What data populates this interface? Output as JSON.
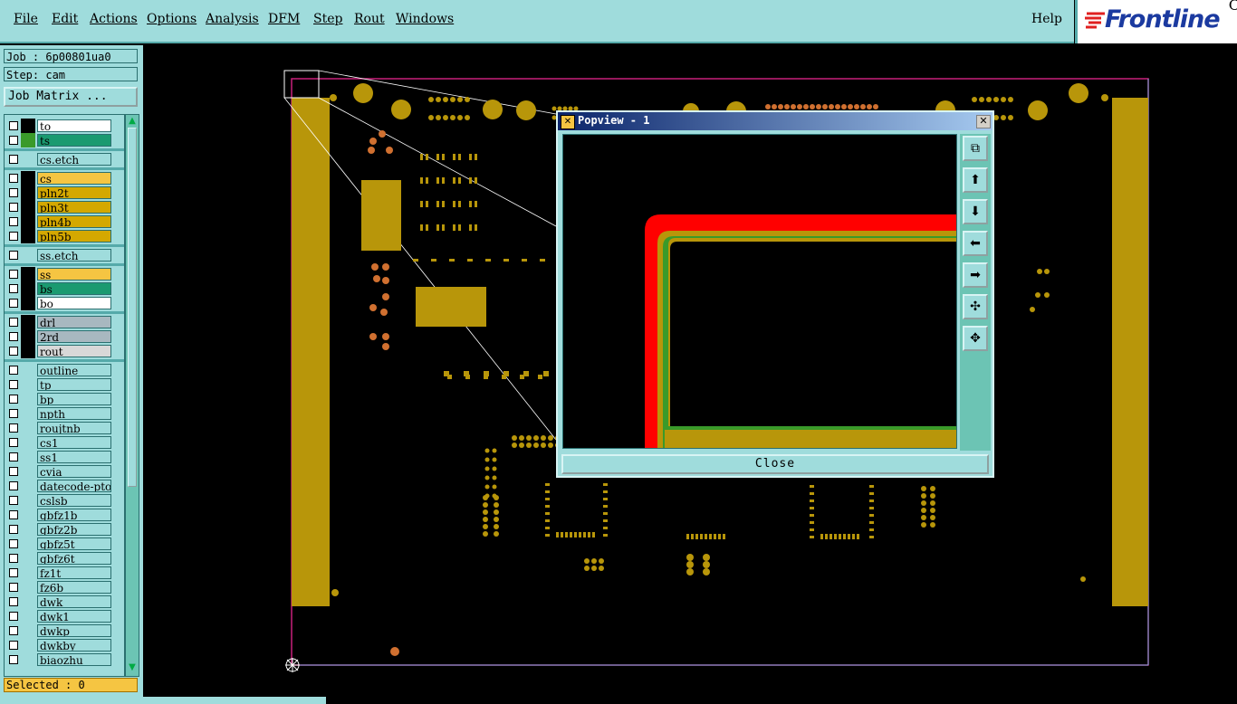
{
  "menubar": {
    "items": [
      "File",
      "Edit",
      "Actions",
      "Options",
      "Analysis",
      "DFM",
      "Step",
      "Rout",
      "Windows"
    ],
    "help": "Help"
  },
  "logo": {
    "text": "Frontline",
    "corner": "C"
  },
  "job": {
    "label": "Job : 6p00801ua0",
    "step": "Step: cam",
    "matrix_button": "Job Matrix ..."
  },
  "layers": [
    {
      "name": "to",
      "color": "#000000",
      "bg": "#ffffff",
      "group": 1
    },
    {
      "name": "ts",
      "color": "#3a9a2a",
      "bg": "#1a9a70",
      "group": 1
    },
    {
      "name": "cs.etch",
      "color": "#9fdcdc",
      "bg": "#9fdcdc",
      "group": 2
    },
    {
      "name": "cs",
      "color": "#000000",
      "bg": "#f5c542",
      "group": 3
    },
    {
      "name": "pln2t",
      "color": "#000000",
      "bg": "#d4a800",
      "group": 3
    },
    {
      "name": "pln3t",
      "color": "#000000",
      "bg": "#d4a800",
      "group": 3
    },
    {
      "name": "pln4b",
      "color": "#000000",
      "bg": "#d4a800",
      "group": 3
    },
    {
      "name": "pln5b",
      "color": "#000000",
      "bg": "#d4a800",
      "group": 3
    },
    {
      "name": "ss.etch",
      "color": "#9fdcdc",
      "bg": "#9fdcdc",
      "group": 4
    },
    {
      "name": "ss",
      "color": "#000000",
      "bg": "#f5c542",
      "group": 5
    },
    {
      "name": "bs",
      "color": "#000000",
      "bg": "#1a9a70",
      "group": 5
    },
    {
      "name": "bo",
      "color": "#000000",
      "bg": "#ffffff",
      "group": 5
    },
    {
      "name": "drl",
      "color": "#000000",
      "bg": "#a8b8c0",
      "group": 6
    },
    {
      "name": "2rd",
      "color": "#000000",
      "bg": "#a8b8c0",
      "group": 6
    },
    {
      "name": "rout",
      "color": "#000000",
      "bg": "#d8d8d8",
      "group": 6
    },
    {
      "name": "outline",
      "color": "#9fdcdc",
      "bg": "#9fdcdc",
      "group": 7
    },
    {
      "name": "tp",
      "color": "#9fdcdc",
      "bg": "#9fdcdc",
      "group": 7
    },
    {
      "name": "bp",
      "color": "#9fdcdc",
      "bg": "#9fdcdc",
      "group": 7
    },
    {
      "name": "npth",
      "color": "#9fdcdc",
      "bg": "#9fdcdc",
      "group": 7
    },
    {
      "name": "roujtnb",
      "color": "#9fdcdc",
      "bg": "#9fdcdc",
      "group": 7
    },
    {
      "name": "cs1",
      "color": "#9fdcdc",
      "bg": "#9fdcdc",
      "group": 7
    },
    {
      "name": "ss1",
      "color": "#9fdcdc",
      "bg": "#9fdcdc",
      "group": 7
    },
    {
      "name": "cvia",
      "color": "#9fdcdc",
      "bg": "#9fdcdc",
      "group": 7
    },
    {
      "name": "datecode-pto",
      "color": "#9fdcdc",
      "bg": "#9fdcdc",
      "group": 7
    },
    {
      "name": "cslsb",
      "color": "#9fdcdc",
      "bg": "#9fdcdc",
      "group": 7
    },
    {
      "name": "gbfz1b",
      "color": "#9fdcdc",
      "bg": "#9fdcdc",
      "group": 7
    },
    {
      "name": "gbfz2b",
      "color": "#9fdcdc",
      "bg": "#9fdcdc",
      "group": 7
    },
    {
      "name": "gbfz5t",
      "color": "#9fdcdc",
      "bg": "#9fdcdc",
      "group": 7
    },
    {
      "name": "gbfz6t",
      "color": "#9fdcdc",
      "bg": "#9fdcdc",
      "group": 7
    },
    {
      "name": "fz1t",
      "color": "#9fdcdc",
      "bg": "#9fdcdc",
      "group": 7
    },
    {
      "name": "fz6b",
      "color": "#9fdcdc",
      "bg": "#9fdcdc",
      "group": 7
    },
    {
      "name": "dwk",
      "color": "#9fdcdc",
      "bg": "#9fdcdc",
      "group": 7
    },
    {
      "name": "dwk1",
      "color": "#9fdcdc",
      "bg": "#9fdcdc",
      "group": 7
    },
    {
      "name": "dwkp",
      "color": "#9fdcdc",
      "bg": "#9fdcdc",
      "group": 7
    },
    {
      "name": "dwkby",
      "color": "#9fdcdc",
      "bg": "#9fdcdc",
      "group": 7
    },
    {
      "name": "biaozhu",
      "color": "#9fdcdc",
      "bg": "#9fdcdc",
      "group": 7
    }
  ],
  "selected": "Selected : 0",
  "popview": {
    "title": "Popview - 1",
    "close_label": "Close",
    "tools": [
      "zoom-window-icon",
      "move-up-icon",
      "move-down-icon",
      "move-left-icon",
      "move-right-icon",
      "zoom-in-icon",
      "zoom-out-icon"
    ]
  },
  "colors": {
    "copper": "#b8960a",
    "board_outline": "#c8207a",
    "red": "#ff0000",
    "green": "#3a9a2a"
  }
}
